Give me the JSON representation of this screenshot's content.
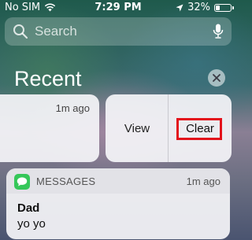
{
  "status_bar": {
    "carrier": "No SIM",
    "time": "7:29 PM",
    "battery_percent": "32%",
    "battery_level": 0.32
  },
  "search": {
    "placeholder": "Search"
  },
  "recent": {
    "title": "Recent"
  },
  "swiped_notification": {
    "time": "1m ago",
    "actions": {
      "view_label": "View",
      "clear_label": "Clear"
    }
  },
  "messages_notification": {
    "app_name": "MESSAGES",
    "time": "1m ago",
    "sender": "Dad",
    "body": "yo yo"
  },
  "colors": {
    "highlight": "#e3121b",
    "messages_green": "#35c759"
  }
}
